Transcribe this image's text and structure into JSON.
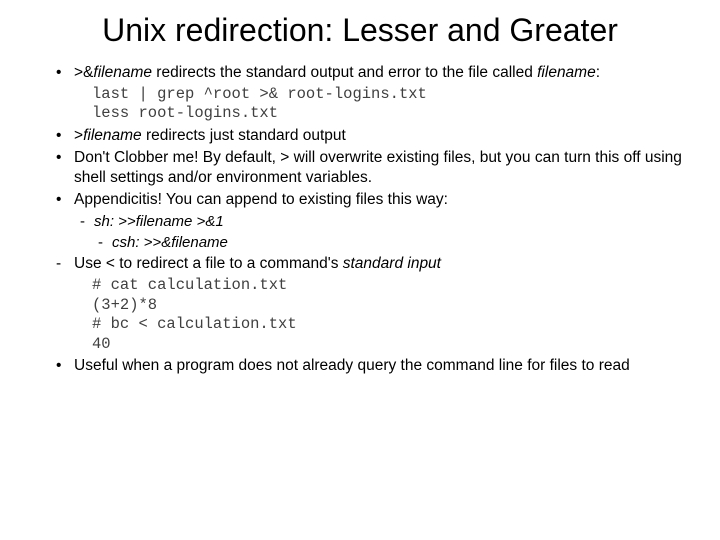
{
  "title": "Unix redirection: Lesser and Greater",
  "items": {
    "i1": {
      "prefix": ">&",
      "fname": "filename",
      "rest": " redirects the standard output and error to the file called ",
      "fname2": "filename",
      "colon": ":"
    },
    "code1a": "last | grep ^root  >& root-logins.txt",
    "code1b": "less root-logins.txt",
    "i2": {
      "prefix": ">",
      "fname": "filename",
      "rest": " redirects just standard output"
    },
    "i3": "Don't Clobber me!  By default, > will overwrite existing files, but you can turn this off using shell settings and/or environment variables.",
    "i4": "Appendicitis!  You can append to existing files this way:",
    "sub1": "sh: >>filename >&1",
    "sub2": "csh: >>&filename",
    "i5": {
      "pre": "Use ",
      "op": "<",
      "mid": " to redirect a file to a command's ",
      "si": "standard input"
    },
    "code2a": "# cat calculation.txt",
    "code2b": "(3+2)*8",
    "code2c": "# bc < calculation.txt",
    "code2d": "40",
    "i6": "Useful when a program does not already query the command line for files to read"
  }
}
